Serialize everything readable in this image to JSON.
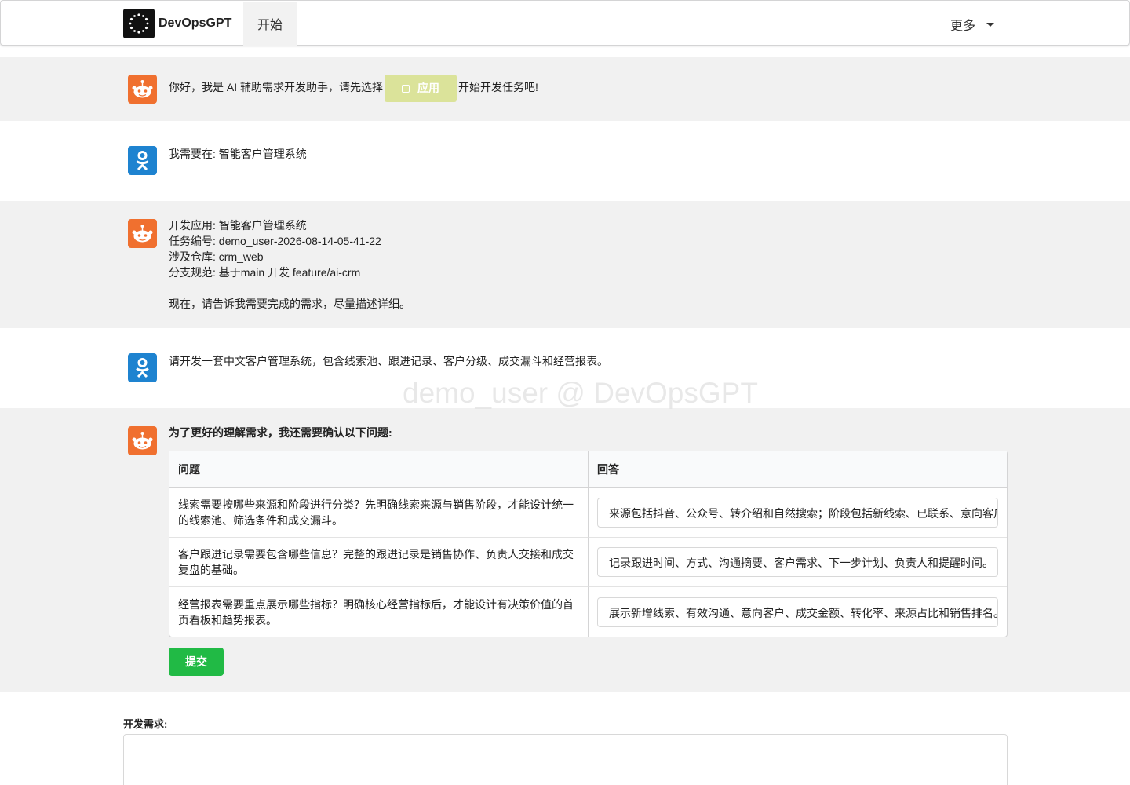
{
  "navbar": {
    "brand": "DevOpsGPT",
    "start": "开始",
    "more": "更多"
  },
  "messages": {
    "greeting": {
      "before": "你好，我是 AI 辅助需求开发助手，请先选择",
      "app_button": "应用",
      "after": "开始开发任务吧!"
    },
    "user_select": "我需要在: 智能客户管理系统",
    "task_info": {
      "app": "开发应用: 智能客户管理系统",
      "task_id": "任务编号: demo_user-2026-08-14-05-41-22",
      "repo": "涉及仓库: crm_web",
      "branch": "分支规范: 基于main 开发 feature/ai-crm",
      "prompt": "现在，请告诉我需要完成的需求，尽量描述详细。"
    },
    "user_requirement": "请开发一套中文客户管理系统，包含线索池、跟进记录、客户分级、成交漏斗和经营报表。",
    "confirm_title": "为了更好的理解需求，我还需要确认以下问题:"
  },
  "watermark": "demo_user @ DevOpsGPT",
  "qa_table": {
    "headers": [
      "问题",
      "回答"
    ],
    "rows": [
      {
        "question": "线索需要按哪些来源和阶段进行分类？先明确线索来源与销售阶段，才能设计统一的线索池、筛选条件和成交漏斗。",
        "answer": "来源包括抖音、公众号、转介绍和自然搜索；阶段包括新线索、已联系、意向客户、成交和流失。"
      },
      {
        "question": "客户跟进记录需要包含哪些信息？完整的跟进记录是销售协作、负责人交接和成交复盘的基础。",
        "answer": "记录跟进时间、方式、沟通摘要、客户需求、下一步计划、负责人和提醒时间。"
      },
      {
        "question": "经营报表需要重点展示哪些指标？明确核心经营指标后，才能设计有决策价值的首页看板和趋势报表。",
        "answer": "展示新增线索、有效沟通、意向客户、成交金额、转化率、来源占比和销售排名。"
      }
    ]
  },
  "submit_label": "提交",
  "requirement_label": "开发需求:",
  "colors": {
    "bot_avatar": "#f0702f",
    "user_avatar": "#1e83d0",
    "submit": "#21ba45",
    "app_button": "#dbe39a"
  }
}
